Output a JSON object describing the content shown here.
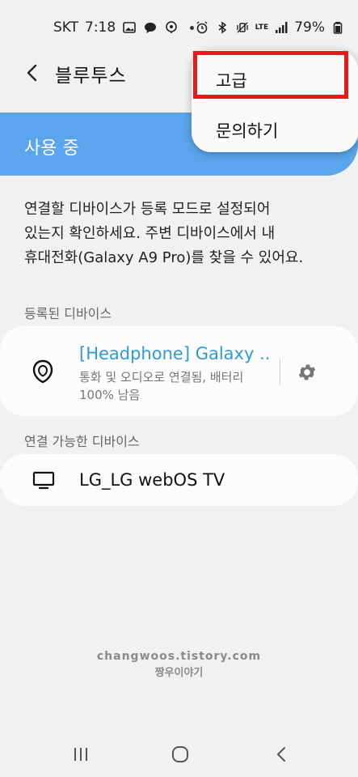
{
  "status_bar": {
    "carrier": "SKT",
    "time": "7:18",
    "lte_label": "LTE",
    "battery": "79%"
  },
  "header": {
    "title": "블루투스"
  },
  "switch": {
    "label": "사용 중",
    "on": true
  },
  "menu": {
    "items": [
      {
        "label": "고급"
      },
      {
        "label": "문의하기"
      }
    ]
  },
  "description": "연결할 디바이스가 등록 모드로 설정되어\n있는지 확인하세요. 주변 디바이스에서 내\n휴대전화(Galaxy A9 Pro)를 찾을 수 있어요.",
  "registered": {
    "title": "등록된 디바이스",
    "devices": [
      {
        "name": "[Headphone] Galaxy ..",
        "status": "통화 및 오디오로 연결됨, 배터리\n100% 남음",
        "icon": "earbuds-icon"
      }
    ]
  },
  "available": {
    "title": "연결 가능한 디바이스",
    "devices": [
      {
        "name": "LG_LG webOS TV",
        "icon": "tv-icon"
      }
    ]
  },
  "watermark": {
    "url": "changwoos.tistory.com",
    "name": "짱우이야기"
  },
  "colors": {
    "accent": "#5aa5ed",
    "link": "#2e9bd7",
    "highlight": "#e51b1b",
    "background": "#f1f1f1"
  }
}
